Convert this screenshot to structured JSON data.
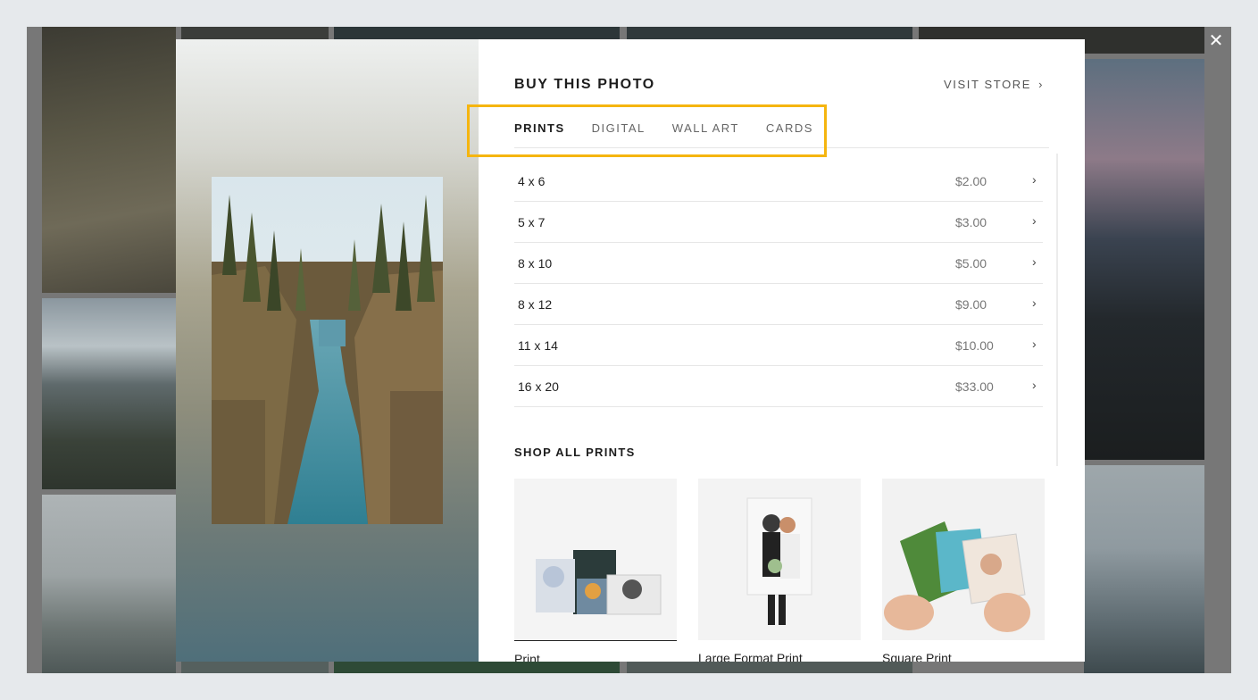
{
  "colors": {
    "highlight": "#f5b50f",
    "accent_text": "#1d1d1d",
    "muted_text": "#777777"
  },
  "close_icon": "close-icon",
  "modal": {
    "title": "BUY THIS PHOTO",
    "visit_store": "VISIT STORE",
    "visit_store_icon": "chevron-right-icon",
    "tabs": [
      {
        "label": "PRINTS",
        "active": true
      },
      {
        "label": "DIGITAL",
        "active": false
      },
      {
        "label": "WALL ART",
        "active": false
      },
      {
        "label": "CARDS",
        "active": false
      }
    ],
    "prints": [
      {
        "size": "4 x 6",
        "price": "$2.00"
      },
      {
        "size": "5 x 7",
        "price": "$3.00"
      },
      {
        "size": "8 x 10",
        "price": "$5.00"
      },
      {
        "size": "8 x 12",
        "price": "$9.00"
      },
      {
        "size": "11 x 14",
        "price": "$10.00"
      },
      {
        "size": "16 x 20",
        "price": "$33.00"
      }
    ],
    "shop_all": "SHOP ALL PRINTS",
    "products": [
      {
        "label": "Print"
      },
      {
        "label": "Large Format Print"
      },
      {
        "label": "Square Print"
      }
    ]
  }
}
